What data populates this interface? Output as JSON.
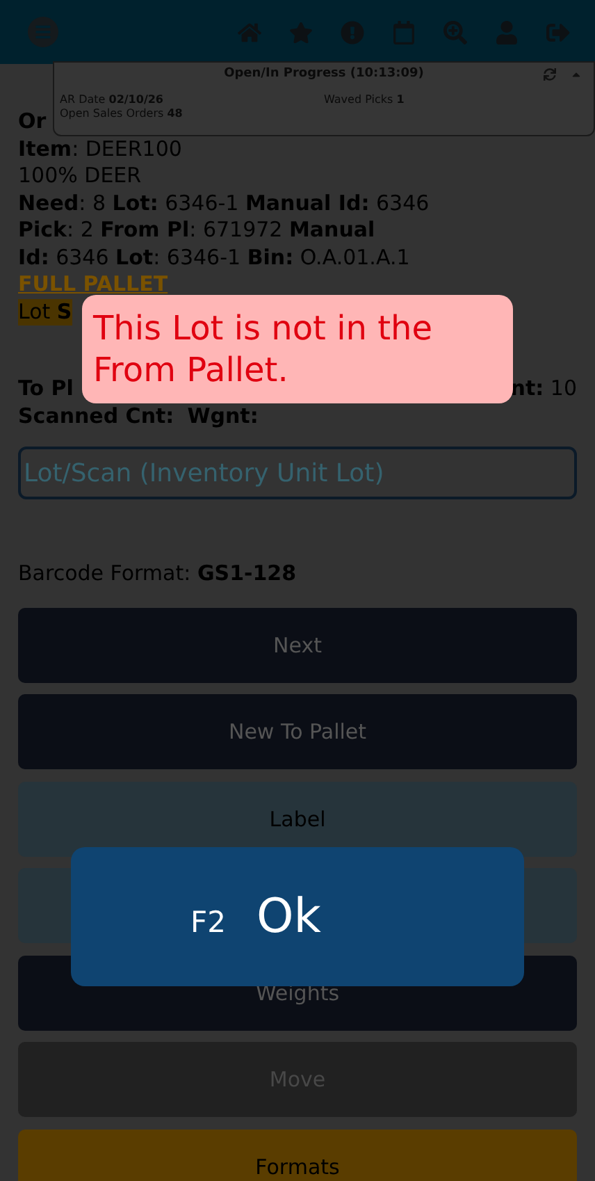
{
  "status_panel": {
    "title": "Open/In Progress (10:13:09)",
    "rows": [
      [
        {
          "label": "AR Date",
          "value": "02/10/26"
        },
        {
          "label": "Waved Picks",
          "value": "1"
        }
      ],
      [
        {
          "label": "Open Sales Orders",
          "value": "48"
        }
      ]
    ]
  },
  "detail_lines": [
    "**Or**",
    "**Item**: DEER100",
    "100% DEER",
    "**Need**: 8 **Lot:** 6346-1 **Manual Id:** 6346",
    "**Pick**: 2 **From Pl**: 671972 **Manual**",
    "**Id:** 6346 **Lot**: 6346-1 **Bin:** O.A.01.A.1"
  ],
  "full_pallet": "FULL PALLET",
  "lot_status": "Lot **S**",
  "to_pallet_row": {
    "left": "**To Pl**",
    "right": "**nt:** 10"
  },
  "scanned_line": "**Scanned Cnt:**  **Wgnt:**",
  "lot_field": {
    "placeholder": "Lot/Scan (Inventory Unit Lot)"
  },
  "barcode_format": "Barcode Format: **GS1-128**",
  "buttons": [
    {
      "label": "Next",
      "kind": "primary"
    },
    {
      "label": "New To Pallet",
      "kind": "primary"
    },
    {
      "label": "Label",
      "kind": "info"
    },
    {
      "kind": "info"
    },
    {
      "label": "Weights",
      "kind": "primary"
    },
    {
      "label": "Move",
      "kind": "disabled"
    },
    {
      "label": "Formats",
      "kind": "warning"
    }
  ],
  "error_message": "This Lot is not in the From Pallet.",
  "ok_dialog": {
    "key": "F2",
    "label": "Ok"
  }
}
